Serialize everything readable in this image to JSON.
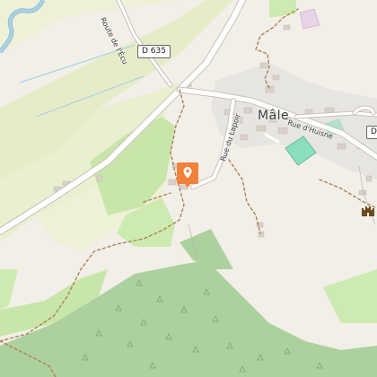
{
  "map": {
    "labels": {
      "place": "Mâle",
      "route_ecu": "Route de l'Écu",
      "rue_huisne": "Rue d'Huisne",
      "rue_lapoir": "Rue du Lapoir"
    },
    "shields": {
      "d635": "D 635",
      "d_partial": "D"
    },
    "marker": {
      "icon": "map-pin-icon",
      "color": "#f0813a"
    },
    "poi": {
      "icon": "castle-icon",
      "color": "#6b4a1b"
    }
  }
}
